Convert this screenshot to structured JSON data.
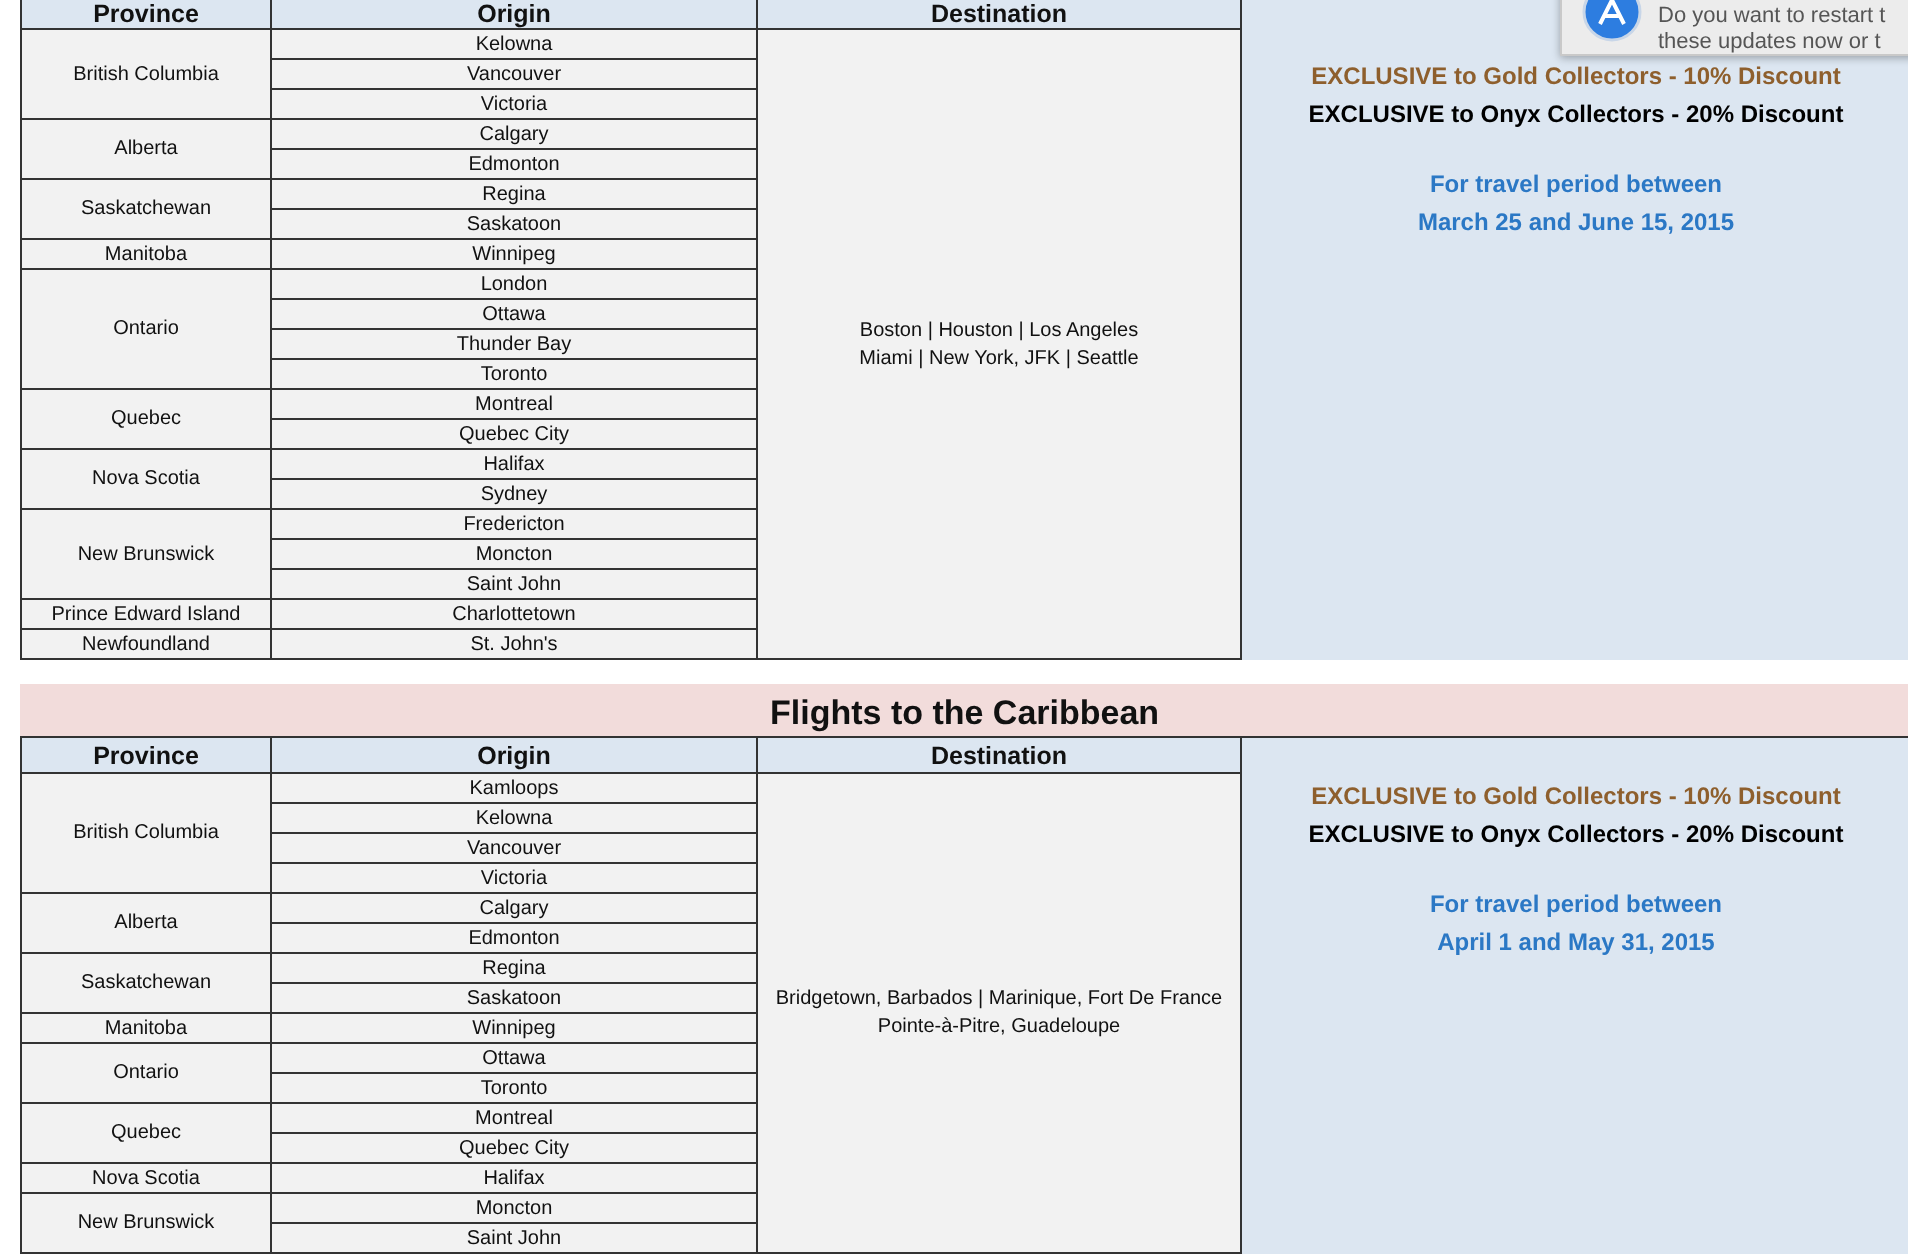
{
  "tables": [
    {
      "columns": [
        "Province",
        "Origin",
        "Destination"
      ],
      "groups": [
        {
          "province": "British Columbia",
          "origins": [
            "Kelowna",
            "Vancouver",
            "Victoria"
          ]
        },
        {
          "province": "Alberta",
          "origins": [
            "Calgary",
            "Edmonton"
          ]
        },
        {
          "province": "Saskatchewan",
          "origins": [
            "Regina",
            "Saskatoon"
          ]
        },
        {
          "province": "Manitoba",
          "origins": [
            "Winnipeg"
          ]
        },
        {
          "province": "Ontario",
          "origins": [
            "London",
            "Ottawa",
            "Thunder Bay",
            "Toronto"
          ]
        },
        {
          "province": "Quebec",
          "origins": [
            "Montreal",
            "Quebec City"
          ]
        },
        {
          "province": "Nova Scotia",
          "origins": [
            "Halifax",
            "Sydney"
          ]
        },
        {
          "province": "New Brunswick",
          "origins": [
            "Fredericton",
            "Moncton",
            "Saint John"
          ]
        },
        {
          "province": "Prince Edward Island",
          "origins": [
            "Charlottetown"
          ]
        },
        {
          "province": "Newfoundland",
          "origins": [
            "St. John's"
          ]
        }
      ],
      "destination": [
        "Boston | Houston | Los Angeles",
        "Miami | New York, JFK | Seattle"
      ],
      "offer": {
        "gold": "EXCLUSIVE to Gold Collectors - 10% Discount",
        "onyx": "EXCLUSIVE to Onyx Collectors - 20% Discount",
        "period": [
          "For travel period between",
          "March 25 and June 15, 2015"
        ]
      }
    },
    {
      "title": "Flights to the Caribbean",
      "columns": [
        "Province",
        "Origin",
        "Destination"
      ],
      "groups": [
        {
          "province": "British Columbia",
          "origins": [
            "Kamloops",
            "Kelowna",
            "Vancouver",
            "Victoria"
          ]
        },
        {
          "province": "Alberta",
          "origins": [
            "Calgary",
            "Edmonton"
          ]
        },
        {
          "province": "Saskatchewan",
          "origins": [
            "Regina",
            "Saskatoon"
          ]
        },
        {
          "province": "Manitoba",
          "origins": [
            "Winnipeg"
          ]
        },
        {
          "province": "Ontario",
          "origins": [
            "Ottawa",
            "Toronto"
          ]
        },
        {
          "province": "Quebec",
          "origins": [
            "Montreal",
            "Quebec City"
          ]
        },
        {
          "province": "Nova Scotia",
          "origins": [
            "Halifax"
          ]
        },
        {
          "province": "New Brunswick",
          "origins": [
            "Moncton",
            "Saint John"
          ]
        }
      ],
      "destination": [
        "Bridgetown, Barbados  | Marinique, Fort De France",
        "Pointe-à-Pitre, Guadeloupe"
      ],
      "offer": {
        "gold": "EXCLUSIVE to Gold Collectors - 10% Discount",
        "onyx": "EXCLUSIVE to Onyx Collectors - 20% Discount",
        "period": [
          "For travel period between",
          "April 1 and May 31, 2015"
        ]
      }
    }
  ],
  "notification": {
    "lines": [
      "Do you want to restart t",
      "these updates now or t"
    ]
  }
}
